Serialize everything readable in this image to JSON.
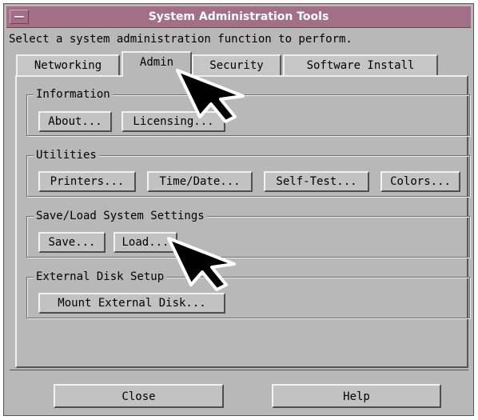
{
  "window": {
    "title": "System Administration Tools",
    "prompt": "Select a system administration function to perform."
  },
  "tabs": [
    {
      "label": "Networking",
      "active": false
    },
    {
      "label": "Admin",
      "active": true
    },
    {
      "label": "Security",
      "active": false
    },
    {
      "label": "Software Install",
      "active": false
    }
  ],
  "groups": {
    "information": {
      "label": "Information",
      "buttons": [
        "About...",
        "Licensing..."
      ]
    },
    "utilities": {
      "label": "Utilities",
      "buttons": [
        "Printers...",
        "Time/Date...",
        "Self-Test...",
        "Colors..."
      ]
    },
    "save_load": {
      "label": "Save/Load System Settings",
      "buttons": [
        "Save...",
        "Load..."
      ]
    },
    "external_disk": {
      "label": "External Disk Setup",
      "buttons": [
        "Mount External Disk..."
      ]
    }
  },
  "footer": {
    "close_label": "Close",
    "help_label": "Help"
  },
  "colors": {
    "titlebar": "#a36f86",
    "window_bg": "#b8b8b8"
  },
  "icons": [
    "system-menu-icon",
    "mouse-pointer-icon"
  ]
}
